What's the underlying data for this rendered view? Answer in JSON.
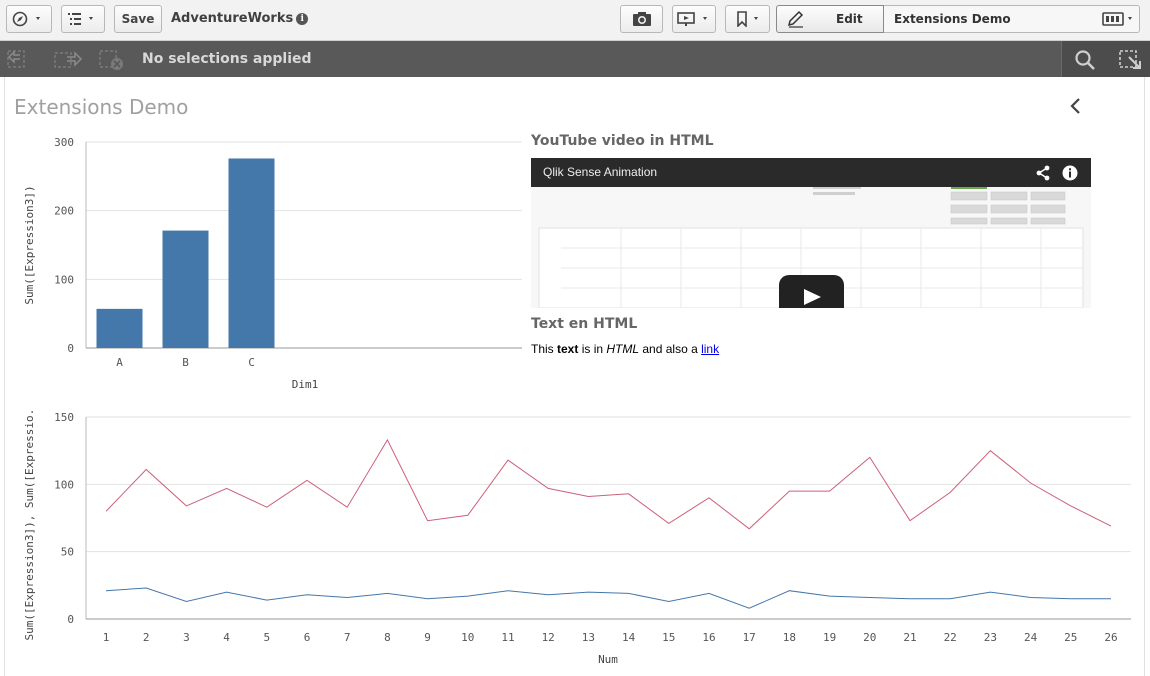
{
  "toolbar": {
    "save_label": "Save",
    "app_title": "AdventureWorks",
    "info_glyph": "i",
    "edit_label": "Edit",
    "sheet_name": "Extensions Demo"
  },
  "selections": {
    "status_text": "No selections applied"
  },
  "sheet": {
    "title": "Extensions Demo"
  },
  "youtube": {
    "title": "YouTube video in HTML",
    "video_title": "Qlik Sense Animation"
  },
  "text_object": {
    "title": "Text en HTML",
    "parts": [
      "This ",
      "text",
      " is in ",
      "HTML",
      " and also a ",
      "link"
    ]
  },
  "chart_data": [
    {
      "type": "bar",
      "categories": [
        "A",
        "B",
        "C"
      ],
      "values": [
        57,
        171,
        276
      ],
      "xlabel": "Dim1",
      "ylabel": "Sum([Expression3])",
      "ylim": [
        0,
        300
      ],
      "yticks": [
        0,
        100,
        200,
        300
      ],
      "color": "#4477aa",
      "grid": true
    },
    {
      "type": "line",
      "x": [
        1,
        2,
        3,
        4,
        5,
        6,
        7,
        8,
        9,
        10,
        11,
        12,
        13,
        14,
        15,
        16,
        17,
        18,
        19,
        20,
        21,
        22,
        23,
        24,
        25,
        26
      ],
      "series": [
        {
          "values": [
            80,
            111,
            84,
            97,
            83,
            103,
            83,
            133,
            73,
            77,
            118,
            97,
            91,
            93,
            71,
            90,
            67,
            95,
            95,
            120,
            73,
            94,
            125,
            101,
            84,
            69
          ],
          "color": "#cc5f79"
        },
        {
          "values": [
            21,
            23,
            13,
            20,
            14,
            18,
            16,
            19,
            15,
            17,
            21,
            18,
            20,
            19,
            13,
            19,
            8,
            21,
            17,
            16,
            15,
            15,
            20,
            16,
            15,
            15
          ],
          "color": "#4477aa"
        }
      ],
      "xlabel": "Num",
      "ylabel": "Sum([Expression3]), Sum([Expressio...",
      "ylim": [
        0,
        150
      ],
      "yticks": [
        0,
        50,
        100,
        150
      ],
      "grid": true
    }
  ]
}
